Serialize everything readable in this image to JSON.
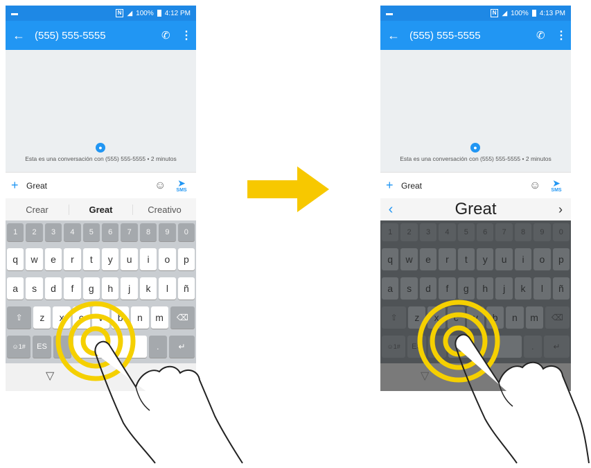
{
  "status": {
    "battery_left": "100%",
    "time_left": "4:12 PM",
    "battery_right": "100%",
    "time_right": "4:13 PM"
  },
  "header": {
    "phone_number": "(555) 555-5555"
  },
  "conversation": {
    "info": "Esta es una conversación con (555) 555-5555 • 2 minutos"
  },
  "compose": {
    "text": "Great",
    "send_label": "SMS"
  },
  "suggestions": [
    "Crear",
    "Great",
    "Creativo"
  ],
  "zoom": {
    "word": "Great"
  },
  "keyboard": {
    "num_row": [
      "1",
      "2",
      "3",
      "4",
      "5",
      "6",
      "7",
      "8",
      "9",
      "0"
    ],
    "row1": [
      "q",
      "w",
      "e",
      "r",
      "t",
      "y",
      "u",
      "i",
      "o",
      "p"
    ],
    "row2": [
      "a",
      "s",
      "d",
      "f",
      "g",
      "h",
      "j",
      "k",
      "l",
      "ñ"
    ],
    "row3": [
      "z",
      "x",
      "c",
      "v",
      "b",
      "n",
      "m"
    ],
    "sym_key": "☺1#",
    "lang_key": "ES"
  },
  "colors": {
    "accent": "#2196f3",
    "arrow": "#f7c800",
    "ripple": "#f5d000"
  }
}
